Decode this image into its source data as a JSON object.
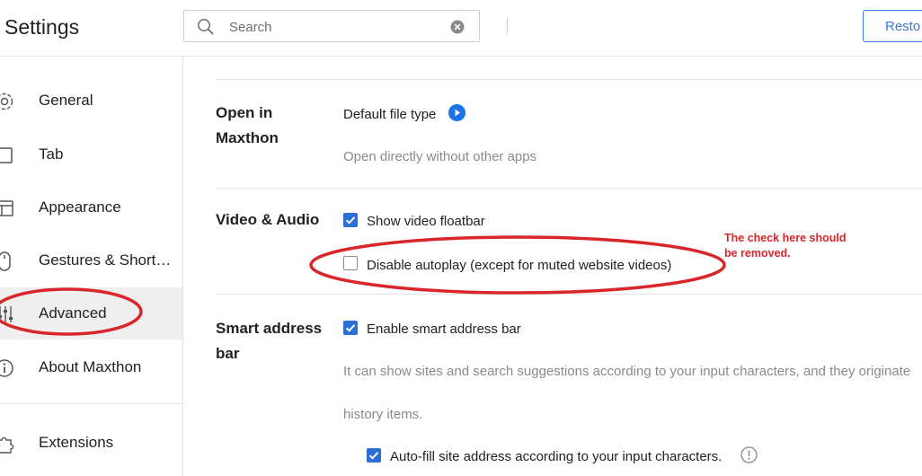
{
  "header": {
    "title": "Settings",
    "search": {
      "placeholder": "Search",
      "value": ""
    },
    "restore_label": "Resto"
  },
  "sidebar": {
    "items": [
      {
        "label": "General",
        "icon": "gear-icon"
      },
      {
        "label": "Tab",
        "icon": "tab-icon"
      },
      {
        "label": "Appearance",
        "icon": "appearance-icon"
      },
      {
        "label": "Gestures & Short…",
        "icon": "mouse-icon"
      },
      {
        "label": "Advanced",
        "icon": "sliders-icon",
        "active": true
      },
      {
        "label": "About Maxthon",
        "icon": "info-icon"
      }
    ],
    "extensions": {
      "label": "Extensions",
      "icon": "puzzle-icon"
    }
  },
  "content": {
    "open_in": {
      "title_line1": "Open in",
      "title_line2": "Maxthon",
      "default_file_type": "Default file type",
      "description": "Open directly without other apps"
    },
    "video_audio": {
      "title": "Video & Audio",
      "show_floatbar": {
        "label": "Show video floatbar",
        "checked": true
      },
      "disable_autoplay": {
        "label": "Disable autoplay (except for muted website videos)",
        "checked": false
      }
    },
    "smart_address": {
      "title_line1": "Smart address",
      "title_line2": "bar",
      "enable": {
        "label": "Enable smart address bar",
        "checked": true
      },
      "description_line1": "It can show sites and search suggestions according to your input characters, and they originate",
      "description_line2": "history items.",
      "autofill": {
        "label": "Auto-fill site address according to your input characters.",
        "checked": true
      }
    }
  },
  "annotation": {
    "note_line1": "The check here should",
    "note_line2": "be removed.",
    "color": "#d9262b"
  },
  "colors": {
    "accent": "#2b6fd6",
    "annotation": "#d9262b"
  }
}
